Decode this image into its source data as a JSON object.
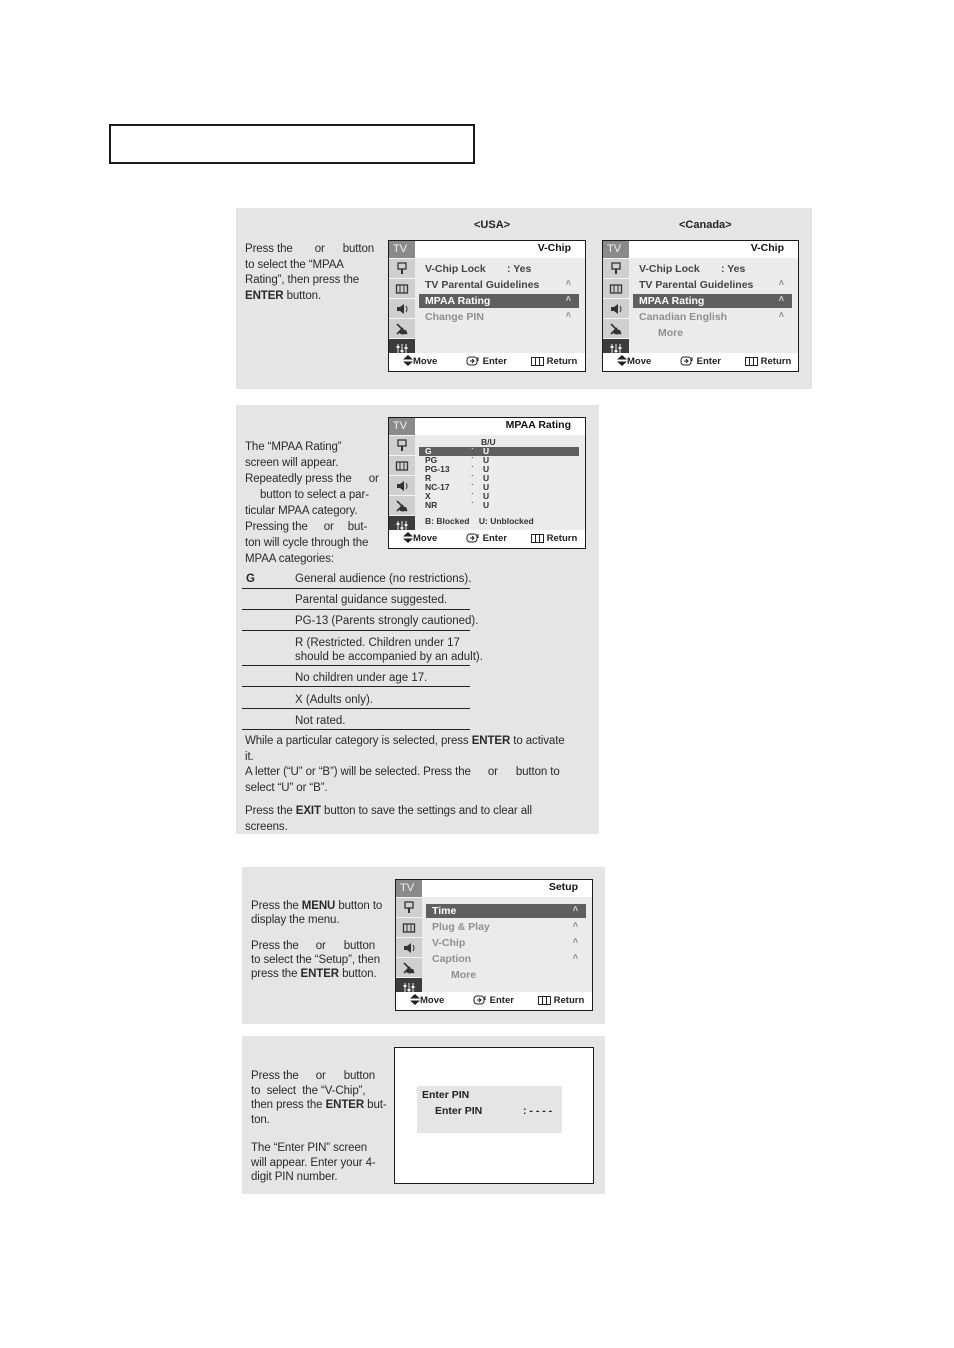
{
  "header": {
    "title": ""
  },
  "step1": {
    "text_html_parts": [
      "Press the",
      "or",
      "button",
      "to select the “MPAA",
      "Rating”, then press the",
      "ENTER",
      "button."
    ],
    "usa_label": "<USA>",
    "canada_label": "<Canada>",
    "usa_menu": {
      "sidebar_tv": "TV",
      "title": "V-Chip",
      "items": [
        {
          "label": "V-Chip Lock",
          "value": ": Yes",
          "state": "normal"
        },
        {
          "label": "TV Parental Guidelines",
          "arrow": "˄",
          "state": "normal"
        },
        {
          "label": "MPAA Rating",
          "arrow": "˄",
          "state": "selected"
        },
        {
          "label": "Change PIN",
          "arrow": "˄",
          "state": "dim"
        }
      ],
      "footer": {
        "move": "Move",
        "enter": "Enter",
        "return": "Return"
      }
    },
    "canada_menu": {
      "sidebar_tv": "TV",
      "title": "V-Chip",
      "items": [
        {
          "label": "V-Chip Lock",
          "value": ": Yes",
          "state": "normal"
        },
        {
          "label": "TV Parental Guidelines",
          "arrow": "˄",
          "state": "normal"
        },
        {
          "label": "MPAA Rating",
          "arrow": "˄",
          "state": "selected"
        },
        {
          "label": "Canadian English",
          "arrow": "˄",
          "state": "dim"
        },
        {
          "label": "More",
          "state": "dim-indent"
        }
      ],
      "footer": {
        "move": "Move",
        "enter": "Enter",
        "return": "Return"
      }
    }
  },
  "step2": {
    "lines": [
      "The “MPAA Rating”",
      "screen will appear.",
      "Repeatedly press the",
      "or",
      "button to select a par-",
      "ticular MPAA category.",
      "Pressing the",
      "or",
      "but-",
      "ton will cycle through the",
      "MPAA categories:"
    ],
    "menu": {
      "sidebar_tv": "TV",
      "title": "MPAA Rating",
      "column_header": "B/U",
      "rows": [
        {
          "rating": "G",
          "dot": "˙",
          "value": "U",
          "selected": true
        },
        {
          "rating": "PG",
          "dot": "˙",
          "value": "U"
        },
        {
          "rating": "PG-13",
          "dot": "˙",
          "value": "U"
        },
        {
          "rating": "R",
          "dot": "˙",
          "value": "U"
        },
        {
          "rating": "NC-17",
          "dot": "˙",
          "value": "U"
        },
        {
          "rating": "X",
          "dot": "˙",
          "value": "U"
        },
        {
          "rating": "NR",
          "dot": "˙",
          "value": "U"
        }
      ],
      "legend": {
        "blocked": "B: Blocked",
        "unblocked": "U: Unblocked"
      },
      "footer": {
        "move": "Move",
        "enter": "Enter",
        "return": "Return"
      }
    },
    "ratings_table": [
      {
        "code": "G",
        "desc": "General audience (no restrictions)."
      },
      {
        "code": "",
        "desc": "Parental guidance suggested."
      },
      {
        "code": "",
        "desc": "PG-13 (Parents strongly cautioned)."
      },
      {
        "code": "",
        "desc": "R (Restricted. Children under 17",
        "desc2": "should be accompanied by an adult)."
      },
      {
        "code": "",
        "desc": "No children under age 17."
      },
      {
        "code": "",
        "desc": "X (Adults only)."
      },
      {
        "code": "",
        "desc": "Not rated."
      }
    ],
    "after": {
      "p1a": "While a particular category is selected, press ",
      "p1b": "ENTER",
      "p1c": " to activate",
      "p1d": "it.",
      "p2a": "A letter (“U” or “B”) will be selected. Press the",
      "p2b": "or",
      "p2c": "button to",
      "p2d": "select “U” or “B”.",
      "p3a": "Press the ",
      "p3b": "EXIT",
      "p3c": " button to save the settings and to clear all",
      "p3d": "screens."
    }
  },
  "step3": {
    "t1a": "Press the ",
    "t1b": "MENU",
    "t1c": " button to",
    "t1d": "display the menu.",
    "t2a": "Press the",
    "t2b": "or",
    "t2c": "button",
    "t2d": "to select the “Setup”, then",
    "t2e": "press the ",
    "t2f": "ENTER",
    "t2g": " button.",
    "menu": {
      "sidebar_tv": "TV",
      "title": "Setup",
      "items": [
        {
          "label": "Time",
          "arrow": "˄",
          "state": "selected"
        },
        {
          "label": "Plug & Play",
          "arrow": "˄",
          "state": "dim"
        },
        {
          "label": "V-Chip",
          "arrow": "˄",
          "state": "dim"
        },
        {
          "label": "Caption",
          "arrow": "˄",
          "state": "dim"
        },
        {
          "label": "More",
          "state": "dim-indent"
        }
      ],
      "footer": {
        "move": "Move",
        "enter": "Enter",
        "return": "Return"
      }
    }
  },
  "step4": {
    "t1a": "Press the",
    "t1b": "or",
    "t1c": "button",
    "t1d": "to  select  the “V-Chip”,",
    "t1e": "then press the ",
    "t1f": "ENTER",
    "t1g": " but-",
    "t1h": "ton.",
    "t2a": "The “Enter PIN” screen",
    "t2b": "will appear. Enter your 4-",
    "t2c": "digit PIN number.",
    "pin": {
      "title": "Enter PIN",
      "label": "Enter PIN",
      "value": ": - - - -"
    }
  },
  "icons": {
    "sidebar": [
      "picture-icon",
      "channel-icon",
      "sound-icon",
      "antenna-icon",
      "setup-icon"
    ],
    "footer": [
      "move-icon",
      "enter-icon",
      "return-icon"
    ]
  }
}
